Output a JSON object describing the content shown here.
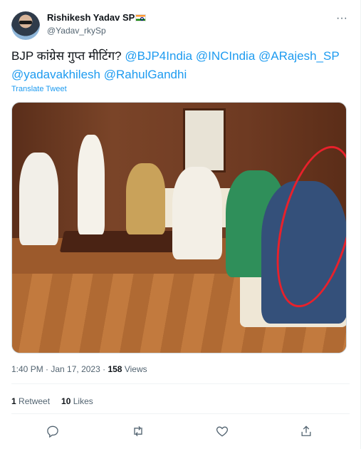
{
  "author": {
    "name": "Rishikesh Yadav SP",
    "handle": "@Yadav_rkySp",
    "avatar_icon": "avatar-icon",
    "flag_icon": "india-flag-icon"
  },
  "tweet": {
    "text_prefix": "BJP कांग्रेस गुप्त मीटिंग? ",
    "mentions": [
      "@BJP4India",
      "@INCIndia",
      "@ARajesh_SP",
      "@yadavakhilesh",
      "@RahulGandhi"
    ],
    "translate_label": "Translate Tweet"
  },
  "meta": {
    "time": "1:40 PM",
    "sep1": " · ",
    "date": "Jan 17, 2023",
    "sep2": " · ",
    "views_count": "158",
    "views_label": " Views"
  },
  "stats": {
    "retweets_count": "1",
    "retweets_label": " Retweet",
    "likes_count": "10",
    "likes_label": " Likes"
  },
  "actions": {
    "reply_icon": "reply-icon",
    "retweet_icon": "retweet-icon",
    "like_icon": "heart-icon",
    "share_icon": "share-icon",
    "more_icon": "more-icon"
  },
  "colors": {
    "accent": "#1d9bf0",
    "text": "#0f1419",
    "muted": "#536471",
    "highlight_circle": "#e8212b"
  }
}
